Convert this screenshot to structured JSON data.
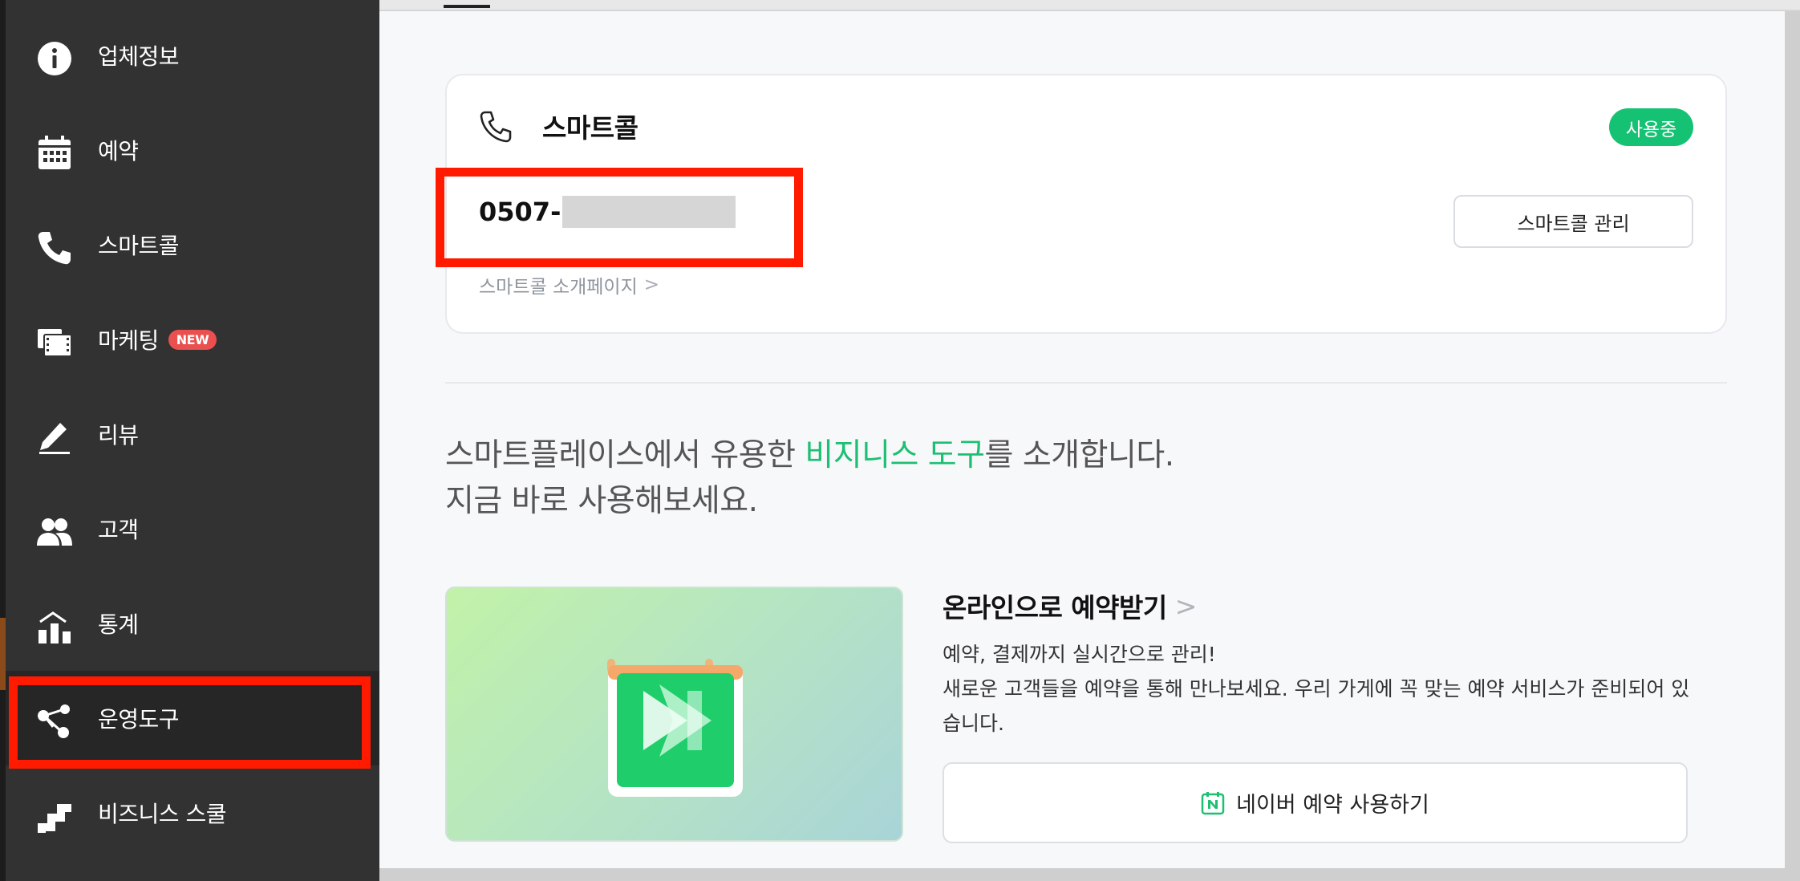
{
  "sidebar": {
    "items": [
      {
        "label": "업체정보",
        "icon": "info-icon"
      },
      {
        "label": "예약",
        "icon": "calendar-icon"
      },
      {
        "label": "스마트콜",
        "icon": "phone-icon"
      },
      {
        "label": "마케팅",
        "icon": "marketing-icon",
        "badge": "NEW"
      },
      {
        "label": "리뷰",
        "icon": "pen-icon"
      },
      {
        "label": "고객",
        "icon": "users-icon"
      },
      {
        "label": "통계",
        "icon": "chart-icon"
      },
      {
        "label": "운영도구",
        "icon": "share-icon"
      },
      {
        "label": "비즈니스 스쿨",
        "icon": "stairs-icon"
      }
    ],
    "active_index": 7
  },
  "smartcall": {
    "title": "스마트콜",
    "status": "사용중",
    "phone_prefix": "0507-",
    "manage_label": "스마트콜 관리",
    "intro_link": "스마트콜 소개페이지",
    "chevron": ">"
  },
  "promo": {
    "headline_pre": "스마트플레이스에서 유용한 ",
    "headline_accent": "비지니스 도구",
    "headline_post": "를 소개합니다.",
    "headline_line2": "지금 바로 사용해보세요."
  },
  "feature": {
    "title": "온라인으로 예약받기",
    "chevron": ">",
    "desc_line1": "예약, 결제까지 실시간으로 관리!",
    "desc_line2": "새로운 고객들을 예약을 통해 만나보세요. 우리 가게에 꼭 맞는 예약 서비스가 준비되어 있습니다.",
    "button_label": "네이버 예약 사용하기"
  },
  "colors": {
    "accent_green": "#1dbf73",
    "badge_green": "#15c274",
    "highlight_red": "#ff1a00",
    "sidebar_bg": "#323232",
    "new_badge_red": "#ea5050"
  }
}
